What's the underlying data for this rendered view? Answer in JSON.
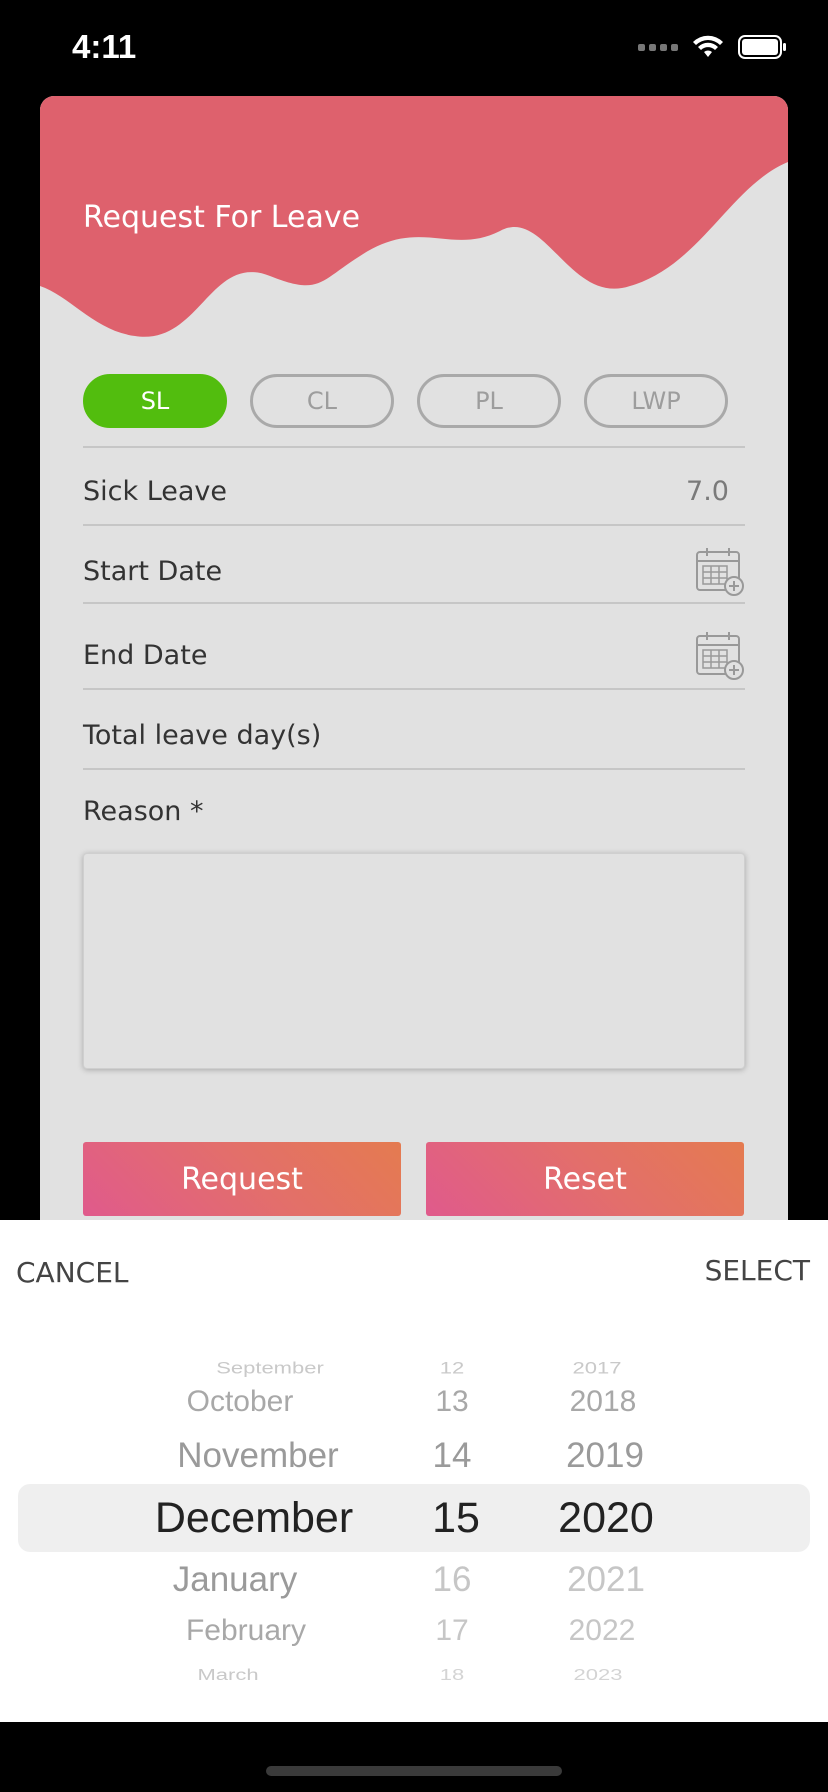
{
  "status_bar": {
    "time": "4:11"
  },
  "card": {
    "title": "Request For Leave",
    "accent_color": "#de616d",
    "leave_types": [
      {
        "label": "SL",
        "active": true
      },
      {
        "label": "CL",
        "active": false
      },
      {
        "label": "PL",
        "active": false
      },
      {
        "label": "LWP",
        "active": false
      }
    ],
    "sick_leave": {
      "label": "Sick Leave",
      "value": "7.0"
    },
    "start_date": {
      "label": "Start Date",
      "icon": "calendar-add-icon"
    },
    "end_date": {
      "label": "End Date",
      "icon": "calendar-add-icon"
    },
    "total_days": {
      "label": "Total leave day(s)"
    },
    "reason": {
      "label": "Reason *",
      "value": ""
    },
    "buttons": {
      "request": "Request",
      "reset": "Reset"
    }
  },
  "picker": {
    "cancel_label": "CANCEL",
    "select_label": "SELECT",
    "months": [
      "September",
      "October",
      "November",
      "December",
      "January",
      "February",
      "March"
    ],
    "days": [
      "12",
      "13",
      "14",
      "15",
      "16",
      "17",
      "18"
    ],
    "years": [
      "2017",
      "2018",
      "2019",
      "2020",
      "2021",
      "2022",
      "2023"
    ],
    "selected": {
      "month": "December",
      "day": "15",
      "year": "2020"
    }
  }
}
